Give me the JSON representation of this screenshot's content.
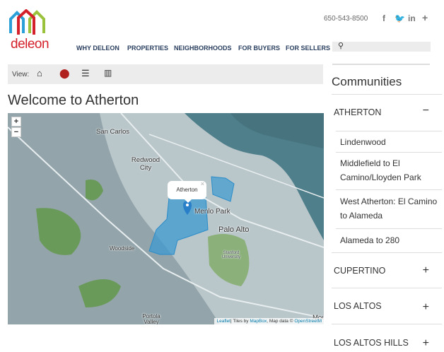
{
  "header": {
    "logo_text": "deleon",
    "phone": "650-543-8500",
    "social": [
      "f",
      "t",
      "in",
      "+"
    ]
  },
  "nav": [
    "WHY DELEON",
    "PROPERTIES",
    "NEIGHBORHOODS",
    "FOR BUYERS",
    "FOR SELLERS"
  ],
  "viewbar": {
    "label": "View:"
  },
  "page_title": "Welcome to Atherton",
  "map": {
    "zoom_in": "+",
    "zoom_out": "−",
    "popup": "Atherton",
    "popup_close": "×",
    "labels": [
      "San Carlos",
      "Redwood City",
      "Menlo Park",
      "Palo Alto",
      "Woodside",
      "Portola Valley",
      "Stanford University",
      "Mou"
    ],
    "attribution": {
      "leaflet": "Leaflet",
      "tiles_by": "| Tiles by ",
      "mapbox": "MapBox",
      "map_data": ", Map data © ",
      "osm": "OpenStreetM"
    }
  },
  "sidebar": {
    "title": "Communities",
    "communities": [
      {
        "name": "ATHERTON",
        "toggle": "−",
        "children": [
          "Lindenwood",
          "Middlefield to El Camino/Lloyden Park",
          "West Atherton: El Camino to Alameda",
          "Alameda to 280"
        ]
      },
      {
        "name": "CUPERTINO",
        "toggle": "+"
      },
      {
        "name": "LOS ALTOS",
        "toggle": "+"
      },
      {
        "name": "LOS ALTOS HILLS",
        "toggle": "+"
      }
    ]
  }
}
